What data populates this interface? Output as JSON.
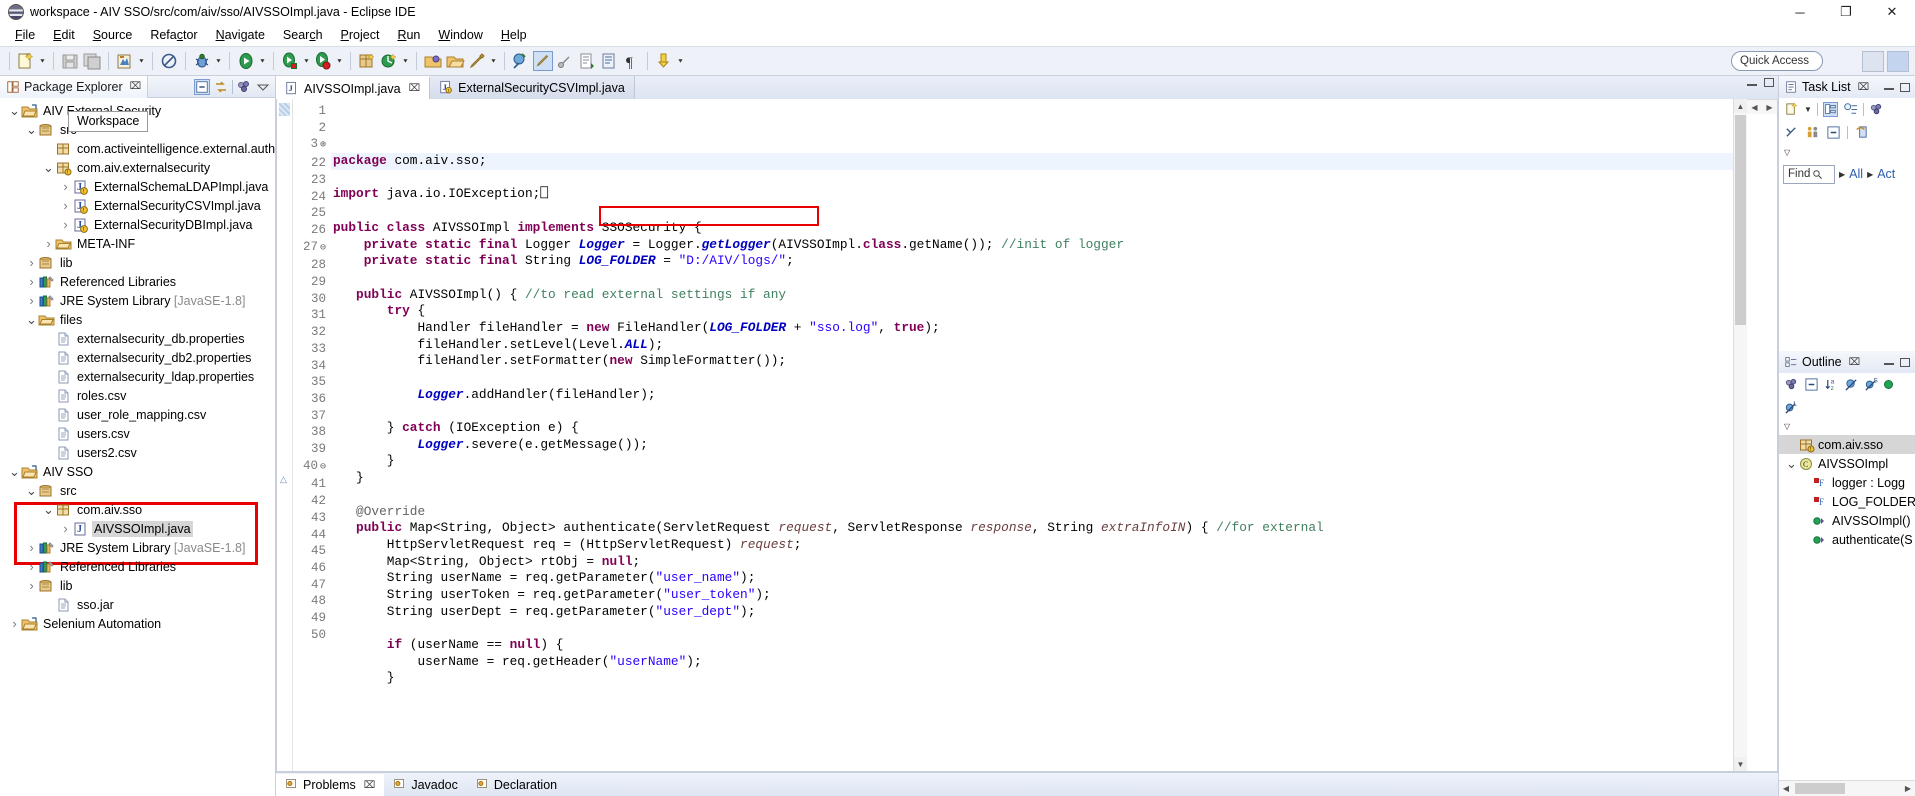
{
  "window": {
    "title": "workspace - AIV SSO/src/com/aiv/sso/AIVSSOImpl.java - Eclipse IDE",
    "minimize": "─",
    "maximize": "❐",
    "close": "✕"
  },
  "menu": {
    "items": [
      "File",
      "Edit",
      "Source",
      "Refactor",
      "Navigate",
      "Search",
      "Project",
      "Run",
      "Window",
      "Help"
    ]
  },
  "toolbar": {
    "quick_access_placeholder": "Quick Access"
  },
  "package_explorer": {
    "title": "Package Explorer",
    "close_label": "⌧",
    "tooltip": "Workspace",
    "tree": [
      {
        "indent": 0,
        "twisty": "v",
        "icon": "project-icon",
        "label": "AIV External Security",
        "dim": ""
      },
      {
        "indent": 1,
        "twisty": "v",
        "icon": "source-folder-icon",
        "label": "src",
        "dim": ""
      },
      {
        "indent": 2,
        "twisty": "",
        "icon": "package-empty-icon",
        "label": "com.activeintelligence.external.auth",
        "dim": ""
      },
      {
        "indent": 2,
        "twisty": "v",
        "icon": "package-icon",
        "label": "com.aiv.externalsecurity",
        "dim": ""
      },
      {
        "indent": 3,
        "twisty": ">",
        "icon": "java-file-icon",
        "label": "ExternalSchemaLDAPImpl.java",
        "dim": ""
      },
      {
        "indent": 3,
        "twisty": ">",
        "icon": "java-file-icon",
        "label": "ExternalSecurityCSVImpl.java",
        "dim": ""
      },
      {
        "indent": 3,
        "twisty": ">",
        "icon": "java-file-icon",
        "label": "ExternalSecurityDBImpl.java",
        "dim": ""
      },
      {
        "indent": 2,
        "twisty": ">",
        "icon": "folder-icon",
        "label": "META-INF",
        "dim": ""
      },
      {
        "indent": 1,
        "twisty": ">",
        "icon": "source-folder-icon",
        "label": "lib",
        "dim": ""
      },
      {
        "indent": 1,
        "twisty": ">",
        "icon": "library-icon",
        "label": "Referenced Libraries",
        "dim": ""
      },
      {
        "indent": 1,
        "twisty": ">",
        "icon": "library-icon",
        "label": "JRE System Library ",
        "dim": "[JavaSE-1.8]"
      },
      {
        "indent": 1,
        "twisty": "v",
        "icon": "folder-icon",
        "label": "files",
        "dim": ""
      },
      {
        "indent": 2,
        "twisty": "",
        "icon": "file-icon",
        "label": "externalsecurity_db.properties",
        "dim": ""
      },
      {
        "indent": 2,
        "twisty": "",
        "icon": "file-icon",
        "label": "externalsecurity_db2.properties",
        "dim": ""
      },
      {
        "indent": 2,
        "twisty": "",
        "icon": "file-icon",
        "label": "externalsecurity_ldap.properties",
        "dim": ""
      },
      {
        "indent": 2,
        "twisty": "",
        "icon": "file-icon",
        "label": "roles.csv",
        "dim": ""
      },
      {
        "indent": 2,
        "twisty": "",
        "icon": "file-icon",
        "label": "user_role_mapping.csv",
        "dim": ""
      },
      {
        "indent": 2,
        "twisty": "",
        "icon": "file-icon",
        "label": "users.csv",
        "dim": ""
      },
      {
        "indent": 2,
        "twisty": "",
        "icon": "file-icon",
        "label": "users2.csv",
        "dim": ""
      },
      {
        "indent": 0,
        "twisty": "v",
        "icon": "project-icon",
        "label": "AIV SSO",
        "dim": ""
      },
      {
        "indent": 1,
        "twisty": "v",
        "icon": "source-folder-icon",
        "label": "src",
        "dim": ""
      },
      {
        "indent": 2,
        "twisty": "v",
        "icon": "package-empty-icon",
        "label": "com.aiv.sso",
        "dim": ""
      },
      {
        "indent": 3,
        "twisty": ">",
        "icon": "java-file-icon",
        "label": "AIVSSOImpl.java",
        "dim": "",
        "selected": true
      },
      {
        "indent": 1,
        "twisty": ">",
        "icon": "library-icon",
        "label": "JRE System Library ",
        "dim": "[JavaSE-1.8]"
      },
      {
        "indent": 1,
        "twisty": ">",
        "icon": "library-icon",
        "label": "Referenced Libraries",
        "dim": ""
      },
      {
        "indent": 1,
        "twisty": ">",
        "icon": "source-folder-icon",
        "label": "lib",
        "dim": ""
      },
      {
        "indent": 2,
        "twisty": "",
        "icon": "file-icon",
        "label": "sso.jar",
        "dim": ""
      },
      {
        "indent": 0,
        "twisty": ">",
        "icon": "project-icon",
        "label": "Selenium Automation",
        "dim": ""
      }
    ],
    "highlight_color": "#e60000"
  },
  "editor": {
    "tabs": [
      {
        "label": "ExternalSecurityCSVImpl.java",
        "active": false,
        "closeable": false
      },
      {
        "label": "AIVSSOImpl.java",
        "active": true,
        "closeable": true,
        "close_label": "⌧"
      }
    ],
    "highlight_color": "#e60000",
    "lines": [
      {
        "n": "1",
        "fold": "",
        "html": "<span class=\"kw\">package</span> com.aiv.sso;"
      },
      {
        "n": "2",
        "fold": "",
        "html": ""
      },
      {
        "n": "3",
        "fold": "⊕",
        "html": "<span class=\"kw\">import</span> java.io.IOException;⎕"
      },
      {
        "n": "22",
        "fold": "",
        "html": ""
      },
      {
        "n": "23",
        "fold": "",
        "html": "<span class=\"kw\">public class</span> AIVSSOImpl <span class=\"kw\">implements</span> SSOSecurity {"
      },
      {
        "n": "24",
        "fold": "",
        "html": "    <span class=\"kw\">private static final</span> Logger <span class=\"fld\">Logger</span> = Logger.<span class=\"fld\">getLogger</span>(AIVSSOImpl.<span class=\"kw\">class</span>.getName()); <span class=\"cm\">//init of logger</span>"
      },
      {
        "n": "25",
        "fold": "",
        "html": "    <span class=\"kw\">private static final</span> String <span class=\"fld\">LOG_FOLDER</span> = <span class=\"st\">\"D:/AIV/logs/\"</span>;"
      },
      {
        "n": "26",
        "fold": "",
        "html": ""
      },
      {
        "n": "27",
        "fold": "⊖",
        "html": "   <span class=\"kw\">public</span> AIVSSOImpl() { <span class=\"cm\">//to read external settings if any</span>"
      },
      {
        "n": "28",
        "fold": "",
        "html": "       <span class=\"kw\">try</span> {"
      },
      {
        "n": "29",
        "fold": "",
        "html": "           Handler fileHandler = <span class=\"kw\">new</span> FileHandler(<span class=\"fld\">LOG_FOLDER</span> + <span class=\"st\">\"sso.log\"</span>, <span class=\"kw\">true</span>);"
      },
      {
        "n": "30",
        "fold": "",
        "html": "           fileHandler.setLevel(Level.<span class=\"fld\">ALL</span>);"
      },
      {
        "n": "31",
        "fold": "",
        "html": "           fileHandler.setFormatter(<span class=\"kw\">new</span> SimpleFormatter());"
      },
      {
        "n": "32",
        "fold": "",
        "html": ""
      },
      {
        "n": "33",
        "fold": "",
        "html": "           <span class=\"fld\">Logger</span>.addHandler(fileHandler);"
      },
      {
        "n": "34",
        "fold": "",
        "html": ""
      },
      {
        "n": "35",
        "fold": "",
        "html": "       } <span class=\"kw\">catch</span> (IOException e) {"
      },
      {
        "n": "36",
        "fold": "",
        "html": "           <span class=\"fld\">Logger</span>.severe(e.getMessage());"
      },
      {
        "n": "37",
        "fold": "",
        "html": "       }"
      },
      {
        "n": "38",
        "fold": "",
        "html": "   }"
      },
      {
        "n": "39",
        "fold": "",
        "html": ""
      },
      {
        "n": "40",
        "fold": "⊖",
        "html": "   <span class=\"an\">@Override</span>"
      },
      {
        "n": "41",
        "fold": "",
        "html": "   <span class=\"kw\">public</span> Map&lt;String, Object&gt; authenticate(ServletRequest <span class=\"par\">request</span>, ServletResponse <span class=\"par\">response</span>, String <span class=\"par\">extraInfoIN</span>) { <span class=\"cm\">//for external</span>"
      },
      {
        "n": "42",
        "fold": "",
        "html": "       HttpServletRequest req = (HttpServletRequest) <span class=\"par\">request</span>;"
      },
      {
        "n": "43",
        "fold": "",
        "html": "       Map&lt;String, Object&gt; rtObj = <span class=\"kw\">null</span>;"
      },
      {
        "n": "44",
        "fold": "",
        "html": "       String userName = req.getParameter(<span class=\"st\">\"user_name\"</span>);"
      },
      {
        "n": "45",
        "fold": "",
        "html": "       String userToken = req.getParameter(<span class=\"st\">\"user_token\"</span>);"
      },
      {
        "n": "46",
        "fold": "",
        "html": "       String userDept = req.getParameter(<span class=\"st\">\"user_dept\"</span>);"
      },
      {
        "n": "47",
        "fold": "",
        "html": ""
      },
      {
        "n": "48",
        "fold": "",
        "html": "       <span class=\"kw\">if</span> (userName == <span class=\"kw\">null</span>) {"
      },
      {
        "n": "49",
        "fold": "",
        "html": "           userName = req.getHeader(<span class=\"st\">\"userName\"</span>);"
      },
      {
        "n": "50",
        "fold": "",
        "html": "       }"
      }
    ]
  },
  "bottom": {
    "tabs": [
      {
        "label": "Problems",
        "active": true,
        "close_label": "⌧"
      },
      {
        "label": "Javadoc",
        "active": false
      },
      {
        "label": "Declaration",
        "active": false
      }
    ]
  },
  "task_list": {
    "title": "Task List",
    "close_label": "⌧",
    "find_label": "Find",
    "filters": [
      "All",
      "Act"
    ]
  },
  "outline": {
    "title": "Outline",
    "close_label": "⌧",
    "items": [
      {
        "indent": 0,
        "twisty": "",
        "icon": "package-icon",
        "label": "com.aiv.sso",
        "selected": true
      },
      {
        "indent": 0,
        "twisty": "v",
        "icon": "class-icon",
        "label": "AIVSSOImpl",
        "selected": false
      },
      {
        "indent": 1,
        "twisty": "",
        "icon": "private-field-icon",
        "label": "logger : Logg",
        "selected": false
      },
      {
        "indent": 1,
        "twisty": "",
        "icon": "private-field-icon",
        "label": "LOG_FOLDER",
        "selected": false
      },
      {
        "indent": 1,
        "twisty": "",
        "icon": "public-method-icon",
        "label": "AIVSSOImpl()",
        "selected": false
      },
      {
        "indent": 1,
        "twisty": "",
        "icon": "public-method-icon",
        "label": "authenticate(S",
        "selected": false
      }
    ]
  }
}
